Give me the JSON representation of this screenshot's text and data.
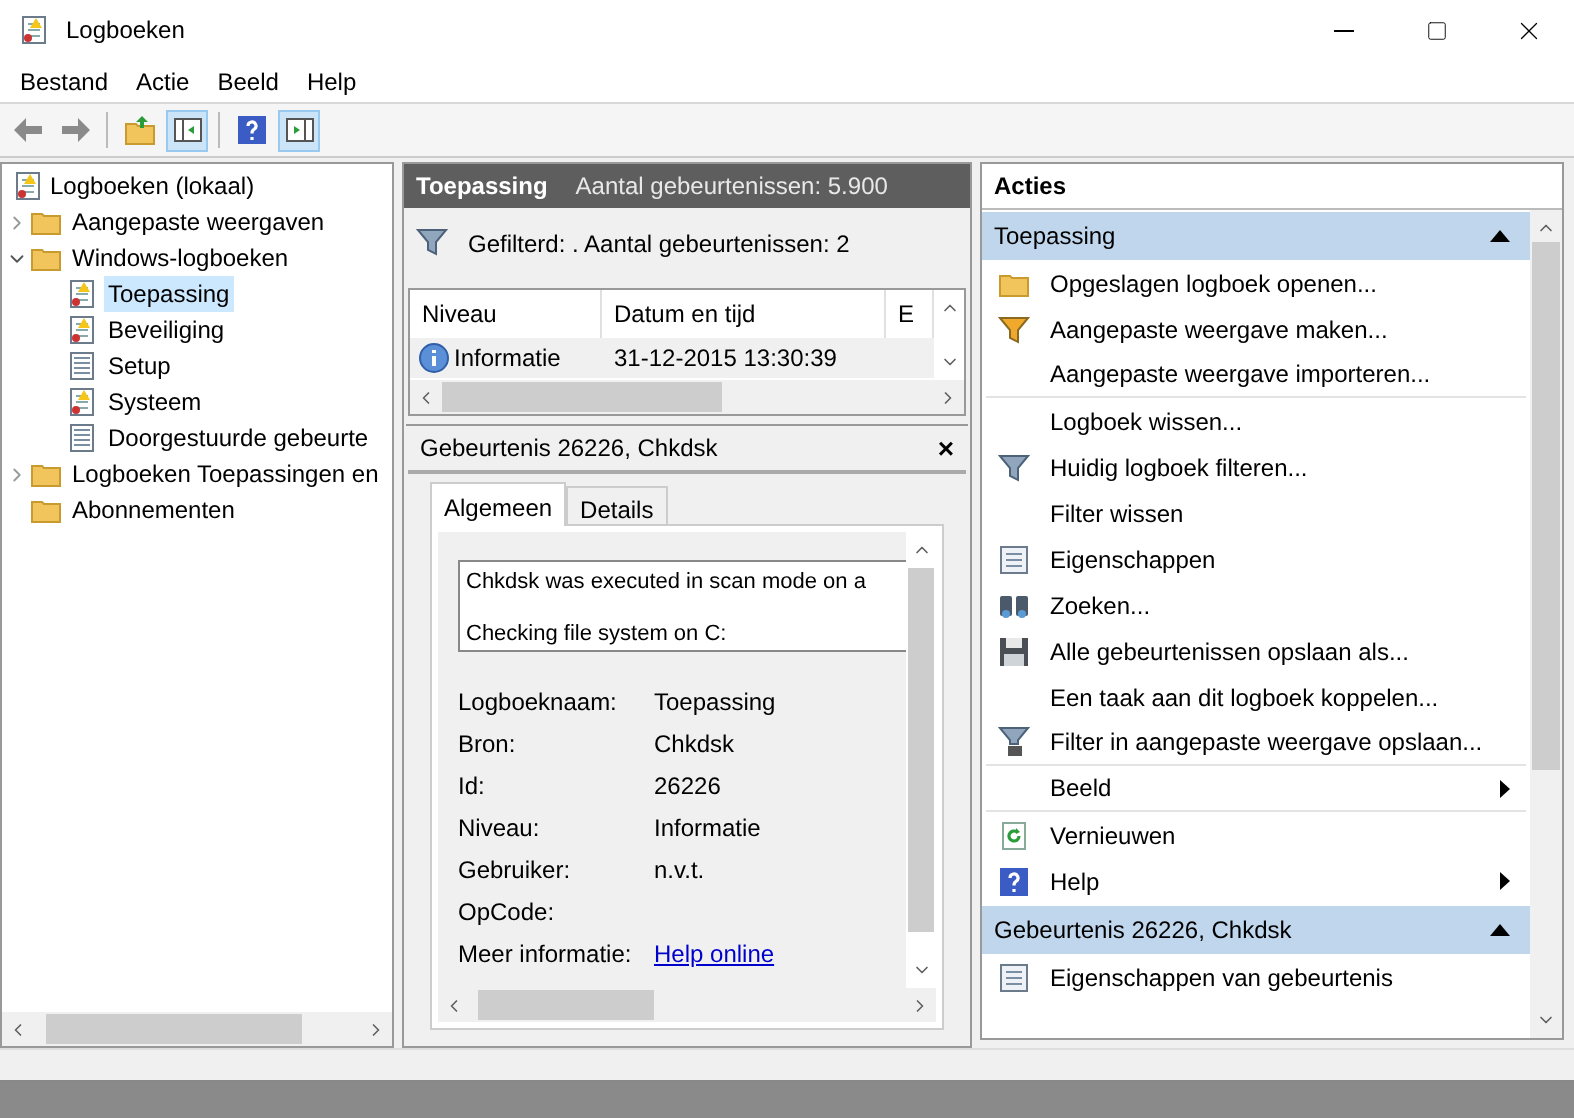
{
  "window": {
    "title": "Logboeken"
  },
  "menu": [
    "Bestand",
    "Actie",
    "Beeld",
    "Help"
  ],
  "toolbar": [
    {
      "kind": "back",
      "selected": false
    },
    {
      "kind": "forward",
      "selected": false
    },
    {
      "kind": "upfolder",
      "selected": false
    },
    {
      "kind": "paneleft",
      "selected": true
    },
    {
      "kind": "help",
      "selected": false
    },
    {
      "kind": "paneright",
      "selected": true
    }
  ],
  "tree": {
    "label": "Logboeken (lokaal)",
    "kind": "log",
    "children": [
      {
        "label": "Aangepaste weergaven",
        "kind": "folder",
        "expanded": false,
        "selected": false
      },
      {
        "label": "Windows-logboeken",
        "kind": "folder",
        "expanded": true,
        "selected": false,
        "children": [
          {
            "label": "Toepassing",
            "kind": "log",
            "selected": true
          },
          {
            "label": "Beveiliging",
            "kind": "log",
            "selected": false
          },
          {
            "label": "Setup",
            "kind": "list",
            "selected": false
          },
          {
            "label": "Systeem",
            "kind": "log",
            "selected": false
          },
          {
            "label": "Doorgestuurde gebeurte",
            "kind": "list",
            "selected": false
          }
        ]
      },
      {
        "label": "Logboeken Toepassingen en",
        "kind": "folder",
        "expanded": false,
        "selected": false
      },
      {
        "label": "Abonnementen",
        "kind": "folder",
        "selected": false
      }
    ]
  },
  "log_header": {
    "title": "Toepassing",
    "count": "Aantal gebeurtenissen: 5.900"
  },
  "filter_text": "Gefilterd: . Aantal gebeurtenissen: 2",
  "table": {
    "columns": [
      "Niveau",
      "Datum en tijd",
      "E"
    ],
    "rows": [
      {
        "level": "Informatie",
        "datetime": "31-12-2015 13:30:39",
        "selected": true
      }
    ]
  },
  "detail": {
    "title": "Gebeurtenis 26226, Chkdsk",
    "close": "×",
    "tabs": [
      {
        "label": "Algemeen",
        "selected": true
      },
      {
        "label": "Details",
        "selected": false
      }
    ],
    "message": [
      "Chkdsk was executed in scan mode on a",
      "Checking file system on C:"
    ],
    "fields": [
      {
        "label": "Logboeknaam:",
        "value": "Toepassing",
        "kind": "text"
      },
      {
        "label": "Bron:",
        "value": "Chkdsk",
        "kind": "text"
      },
      {
        "label": "Id:",
        "value": "26226",
        "kind": "text"
      },
      {
        "label": "Niveau:",
        "value": "Informatie",
        "kind": "text"
      },
      {
        "label": "Gebruiker:",
        "value": "n.v.t.",
        "kind": "text"
      },
      {
        "label": "OpCode:"
      },
      {
        "label": "Meer informatie:",
        "value": "Help online",
        "kind": "link"
      }
    ]
  },
  "actions": {
    "title": "Acties",
    "sections": [
      {
        "title": "Toepassing",
        "expanded": true,
        "items": [
          {
            "label": "Opgeslagen logboek openen...",
            "kind": "folder",
            "submenu": false,
            "separator_after": false
          },
          {
            "label": "Aangepaste weergave maken...",
            "kind": "filtergold",
            "submenu": false,
            "separator_after": false
          },
          {
            "label": "Aangepaste weergave importeren...",
            "submenu": false,
            "separator_after": true
          },
          {
            "label": "Logboek wissen...",
            "submenu": false,
            "separator_after": false
          },
          {
            "label": "Huidig logboek filteren...",
            "kind": "filter",
            "submenu": false,
            "separator_after": false
          },
          {
            "label": "Filter wissen",
            "submenu": false,
            "separator_after": false
          },
          {
            "label": "Eigenschappen",
            "kind": "properties",
            "submenu": false,
            "separator_after": false
          },
          {
            "label": "Zoeken...",
            "kind": "binoculars",
            "submenu": false,
            "separator_after": false
          },
          {
            "label": "Alle gebeurtenissen opslaan als...",
            "kind": "save",
            "submenu": false,
            "separator_after": false
          },
          {
            "label": "Een taak aan dit logboek koppelen...",
            "submenu": false,
            "separator_after": false
          },
          {
            "label": "Filter in aangepaste weergave opslaan...",
            "kind": "filtersave",
            "submenu": false,
            "separator_after": true
          },
          {
            "label": "Beeld",
            "submenu": true,
            "separator_after": true
          },
          {
            "label": "Vernieuwen",
            "kind": "refresh",
            "submenu": false,
            "separator_after": false
          },
          {
            "label": "Help",
            "kind": "help",
            "submenu": true,
            "separator_after": false
          }
        ]
      },
      {
        "title": "Gebeurtenis 26226, Chkdsk",
        "expanded": true,
        "items": [
          {
            "label": "Eigenschappen van gebeurtenis",
            "kind": "properties",
            "submenu": false
          }
        ]
      }
    ]
  }
}
